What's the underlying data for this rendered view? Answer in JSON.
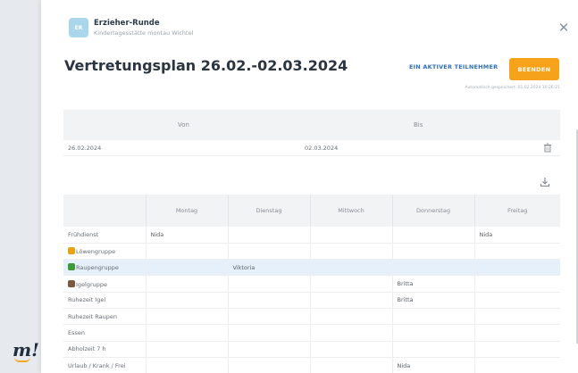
{
  "app": {
    "logo_text": "m!"
  },
  "header": {
    "avatar_initials": "ER",
    "group_name": "Erzieher-Runde",
    "group_subtitle": "Kindertagesstätte montau Wichtel"
  },
  "title": "Vertretungsplan 26.02.-02.03.2024",
  "actions": {
    "participants_label": "EIN AKTIVER TEILNEHMER",
    "finish_label": "BEENDEN"
  },
  "autosave": "Automatisch gespeichert: 01.02.2024 10:26:21",
  "date_range": {
    "headers": {
      "von": "Von",
      "bis": "Bis"
    },
    "von": "26.02.2024",
    "bis": "02.03.2024"
  },
  "plan": {
    "columns": [
      "",
      "Montag",
      "Dienstag",
      "Mittwoch",
      "Donnerstag",
      "Freitag"
    ],
    "rows": [
      {
        "label": "Frühdienst",
        "icon": "",
        "cells": [
          "Nida",
          "",
          "",
          "",
          "Nida"
        ]
      },
      {
        "label": "Löwengruppe",
        "icon": "lion-icon",
        "icon_color": "#e8a317",
        "cells": [
          "",
          "",
          "",
          "",
          ""
        ]
      },
      {
        "label": "Raupengruppe",
        "icon": "caterpillar-icon",
        "icon_color": "#3d9a3a",
        "cells": [
          "",
          "Viktoria",
          "",
          "",
          ""
        ],
        "highlight": true
      },
      {
        "label": "Igelgruppe",
        "icon": "hedgehog-icon",
        "icon_color": "#7a5a3c",
        "cells": [
          "",
          "",
          "",
          "Britta",
          ""
        ]
      },
      {
        "label": "Ruhezeit Igel",
        "icon": "",
        "cells": [
          "",
          "",
          "",
          "Britta",
          ""
        ]
      },
      {
        "label": "Ruhezeit Raupen",
        "icon": "",
        "cells": [
          "",
          "",
          "",
          "",
          ""
        ]
      },
      {
        "label": "Essen",
        "icon": "",
        "cells": [
          "",
          "",
          "",
          "",
          ""
        ]
      },
      {
        "label": "Abholzeit 7 h",
        "icon": "",
        "cells": [
          "",
          "",
          "",
          "",
          ""
        ]
      },
      {
        "label": "Urlaub / Krank / Frei",
        "icon": "",
        "cells": [
          "",
          "",
          "",
          "Nida",
          ""
        ]
      }
    ]
  }
}
